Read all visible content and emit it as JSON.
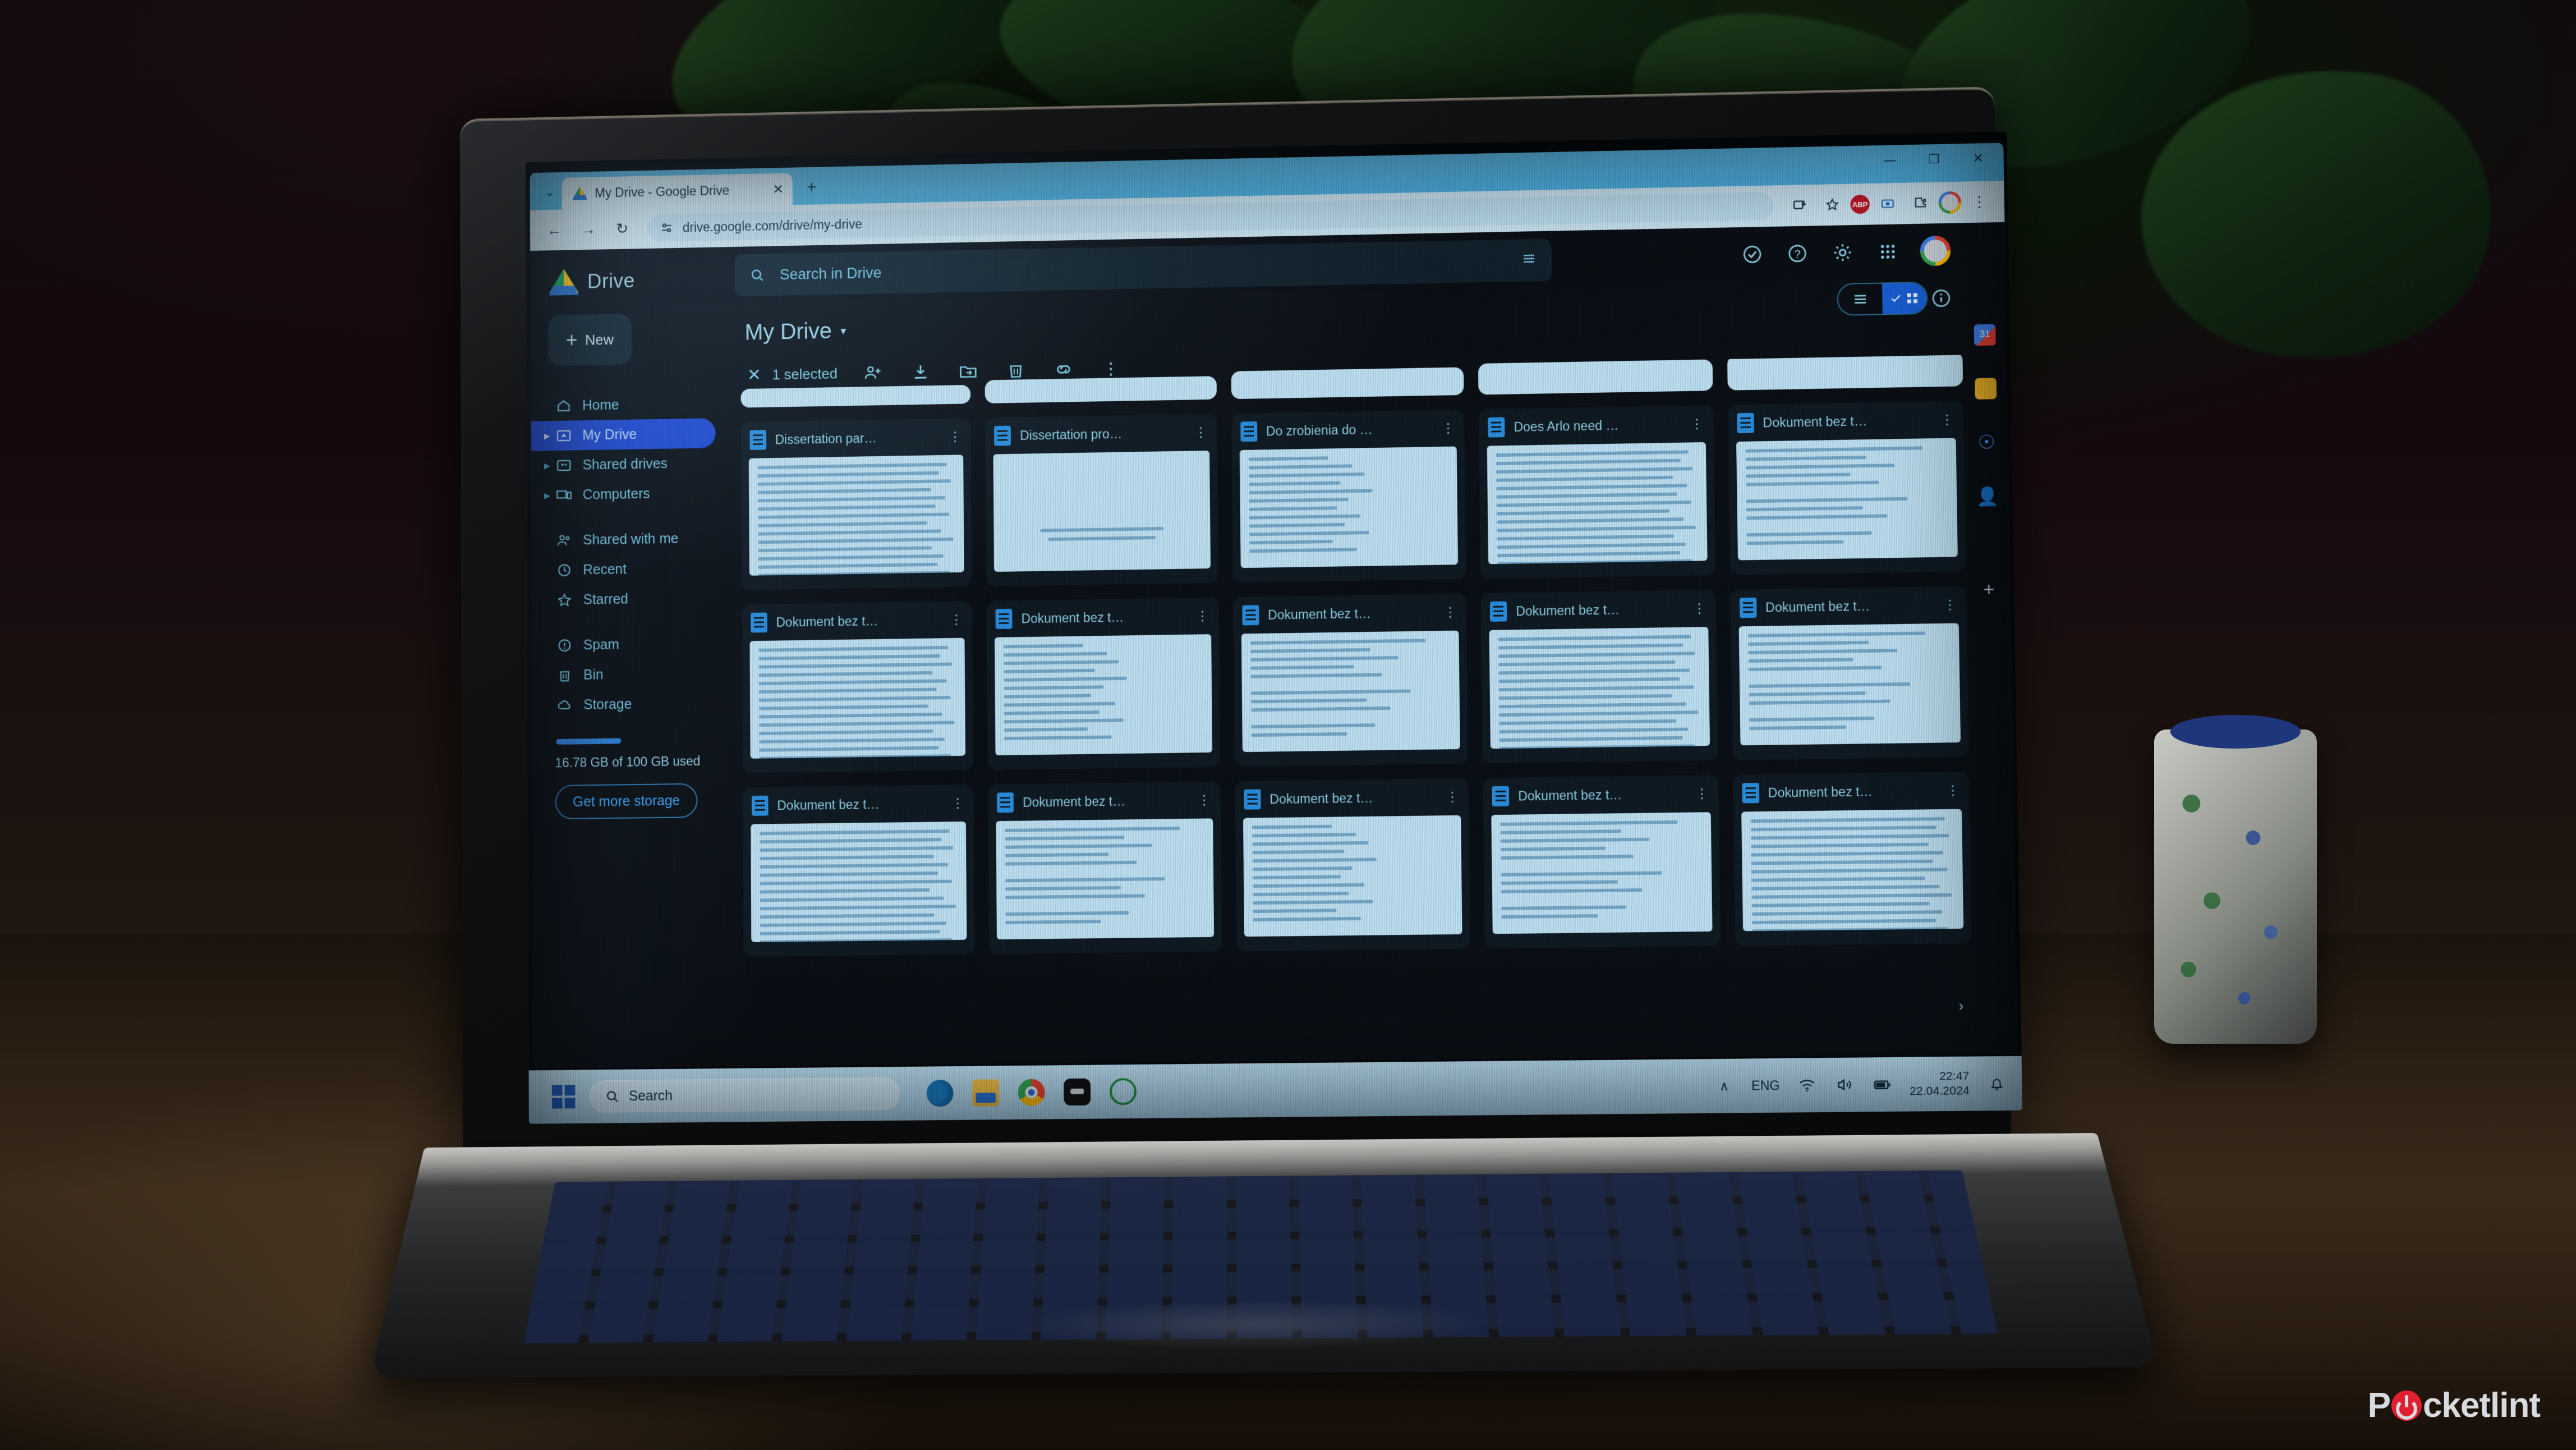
{
  "browser": {
    "tab_title": "My Drive - Google Drive",
    "tab_close": "✕",
    "new_tab": "+",
    "tabstrip_chevron": "⌄",
    "window_minimize": "—",
    "window_maximize": "❐",
    "window_close": "✕",
    "nav_back": "←",
    "nav_forward": "→",
    "reload": "↻",
    "url": "drive.google.com/drive/my-drive",
    "site_info_icon": "tune-icon",
    "install_icon": "install-app-icon",
    "bookmark_icon": "star-icon",
    "extension_abp": "ABP",
    "extension_media": "media-icon",
    "extension_puzzle": "extensions-icon",
    "profile_avatar": "profile-avatar",
    "chrome_menu": "⋮"
  },
  "drive": {
    "brand": "Drive",
    "new_button": "New",
    "search": {
      "placeholder": "Search in Drive",
      "icon": "search-icon",
      "tune_icon": "tune-icon"
    },
    "header_icons": [
      {
        "name": "activity-icon",
        "glyph": "✓"
      },
      {
        "name": "help-icon",
        "glyph": "?"
      },
      {
        "name": "settings-gear-icon",
        "glyph": "⚙"
      },
      {
        "name": "google-apps-grid-icon",
        "glyph": "grid"
      }
    ],
    "nav_primary": [
      {
        "label": "Home",
        "icon": "home-icon",
        "expandable": false,
        "active": false
      },
      {
        "label": "My Drive",
        "icon": "my-drive-icon",
        "expandable": true,
        "active": true
      },
      {
        "label": "Shared drives",
        "icon": "shared-drives-icon",
        "expandable": true,
        "active": false
      },
      {
        "label": "Computers",
        "icon": "computers-icon",
        "expandable": true,
        "active": false
      }
    ],
    "nav_secondary": [
      {
        "label": "Shared with me",
        "icon": "people-icon"
      },
      {
        "label": "Recent",
        "icon": "clock-icon"
      },
      {
        "label": "Starred",
        "icon": "star-icon"
      }
    ],
    "nav_tertiary": [
      {
        "label": "Spam",
        "icon": "spam-icon"
      },
      {
        "label": "Bin",
        "icon": "trash-icon"
      },
      {
        "label": "Storage",
        "icon": "cloud-icon"
      }
    ],
    "storage_text": "16.78 GB of 100 GB used",
    "storage_percent": 16.78,
    "get_more_storage": "Get more storage",
    "breadcrumb": "My Drive",
    "breadcrumb_caret": "▾",
    "selection": {
      "close_glyph": "✕",
      "count_label": "1 selected",
      "actions": [
        {
          "name": "share-icon",
          "glyph": "share"
        },
        {
          "name": "download-icon",
          "glyph": "download"
        },
        {
          "name": "move-to-folder-icon",
          "glyph": "move"
        },
        {
          "name": "delete-icon",
          "glyph": "trash"
        },
        {
          "name": "copy-link-icon",
          "glyph": "link"
        },
        {
          "name": "more-actions-icon",
          "glyph": "⋮"
        }
      ]
    },
    "view_toggle": {
      "list_icon": "list-view-icon",
      "grid_icon": "grid-view-icon",
      "selected": "grid"
    },
    "details_icon": "info-icon",
    "scroll_next": "›",
    "side_panel": [
      {
        "name": "google-calendar-icon",
        "label": "31"
      },
      {
        "name": "google-keep-icon",
        "label": ""
      },
      {
        "name": "google-tasks-icon",
        "label": ""
      },
      {
        "name": "google-contacts-icon",
        "label": ""
      },
      {
        "name": "add-side-panel-icon",
        "label": "+"
      }
    ],
    "files": [
      {
        "name": "Dissertation par…",
        "thumb": "text-dense"
      },
      {
        "name": "Dissertation pro…",
        "thumb": "centered-title"
      },
      {
        "name": "Do zrobienia do …",
        "thumb": "list"
      },
      {
        "name": "Does Arlo need …",
        "thumb": "text-dense"
      },
      {
        "name": "Dokument bez t…",
        "thumb": "text-sparse"
      },
      {
        "name": "Dokument bez t…",
        "thumb": "text-dense"
      },
      {
        "name": "Dokument bez t…",
        "thumb": "list"
      },
      {
        "name": "Dokument bez t…",
        "thumb": "text-sparse"
      },
      {
        "name": "Dokument bez t…",
        "thumb": "text-dense"
      },
      {
        "name": "Dokument bez t…",
        "thumb": "text-sparse"
      },
      {
        "name": "Dokument bez t…",
        "thumb": "text-dense"
      },
      {
        "name": "Dokument bez t…",
        "thumb": "text-sparse"
      },
      {
        "name": "Dokument bez t…",
        "thumb": "list"
      },
      {
        "name": "Dokument bez t…",
        "thumb": "text-sparse"
      },
      {
        "name": "Dokument bez t…",
        "thumb": "text-dense"
      }
    ]
  },
  "taskbar": {
    "start_icon": "windows-start-icon",
    "search_placeholder": "Search",
    "search_icon": "search-icon",
    "apps": [
      {
        "name": "edge-icon"
      },
      {
        "name": "file-explorer-icon"
      },
      {
        "name": "chrome-icon"
      },
      {
        "name": "app-dark-icon"
      },
      {
        "name": "whatsapp-icon"
      }
    ],
    "tray_chevron": "∧",
    "language": "ENG",
    "tray_icons": [
      {
        "name": "wifi-icon"
      },
      {
        "name": "volume-icon"
      },
      {
        "name": "battery-icon"
      }
    ],
    "time": "22:47",
    "date": "22.04.2024",
    "notification_icon": "bell-icon"
  },
  "watermark": {
    "prefix": "P",
    "suffix": "cketlint"
  },
  "colors": {
    "accent_blue": "#1f49d6",
    "drive_text": "#8fd4ea",
    "taskbar": "#b3daef",
    "thumb": "#bfe2f4"
  }
}
